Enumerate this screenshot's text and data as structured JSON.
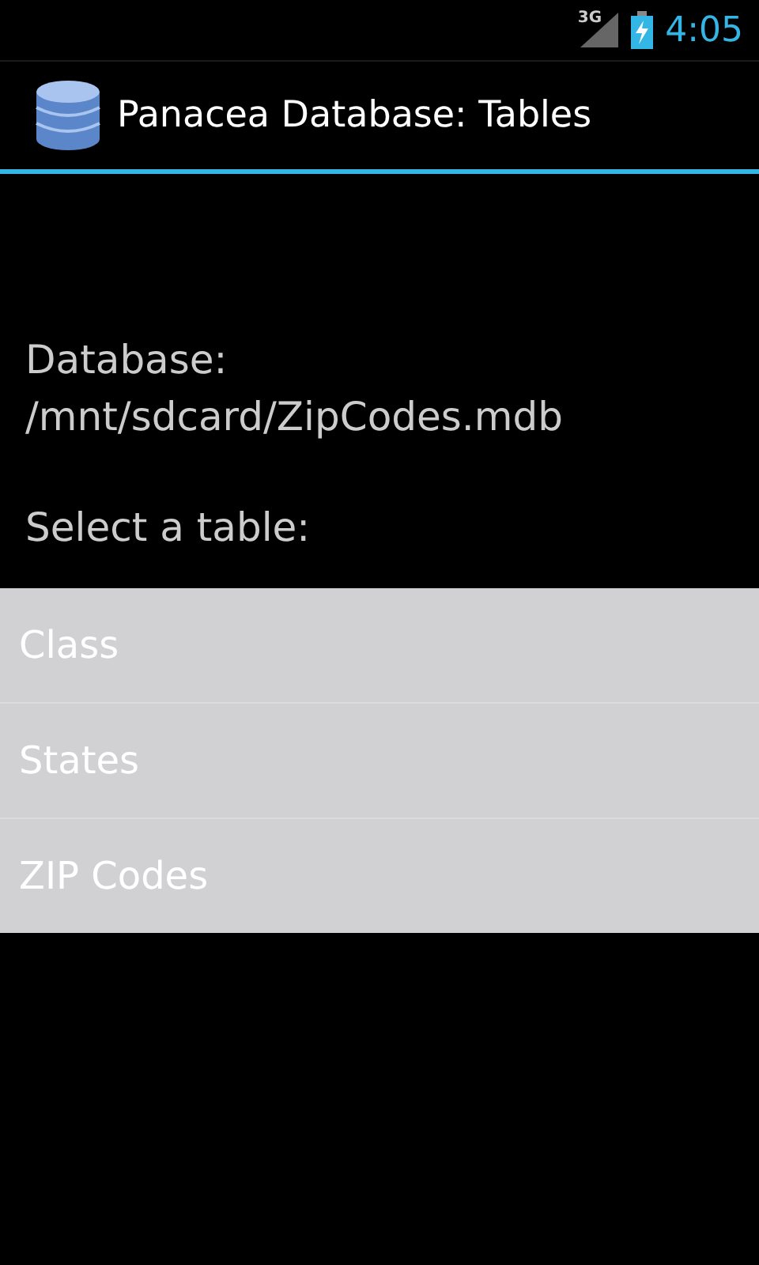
{
  "status_bar": {
    "network": "3G",
    "time": "4:05"
  },
  "action_bar": {
    "title": "Panacea Database: Tables"
  },
  "database": {
    "label": "Database:",
    "path": "/mnt/sdcard/ZipCodes.mdb"
  },
  "prompt": "Select a table:",
  "tables": [
    {
      "label": "Class"
    },
    {
      "label": "States"
    },
    {
      "label": "ZIP Codes"
    }
  ]
}
